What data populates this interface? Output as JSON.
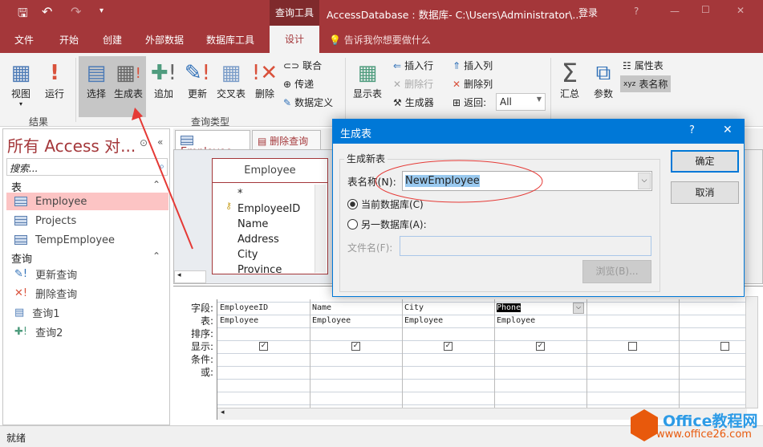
{
  "window": {
    "context_tab": "查询工具",
    "title": "AccessDatabase : 数据库- C:\\Users\\Administrator\\...",
    "signin": "登录",
    "help": "?",
    "minimize": "—",
    "maximize": "☐",
    "close": "✕"
  },
  "qat": {
    "save": "🖫",
    "undo": "↶",
    "redo": "↷",
    "more": "▾"
  },
  "tabs": [
    "文件",
    "开始",
    "创建",
    "外部数据",
    "数据库工具",
    "设计"
  ],
  "tell_me": "告诉我你想要做什么",
  "ribbon": {
    "results": {
      "label": "结果",
      "view": "视图",
      "run": "运行"
    },
    "query_type": {
      "label": "查询类型",
      "select": "选择",
      "make_table": "生成表",
      "append": "追加",
      "update": "更新",
      "crosstab": "交叉表",
      "delete": "删除",
      "union": "联合",
      "passthrough": "传递",
      "data_definition": "数据定义"
    },
    "query_setup": {
      "show_table": "显示表",
      "insert_rows": "插入行",
      "delete_rows": "删除行",
      "builder": "生成器",
      "insert_columns": "插入列",
      "delete_columns": "删除列",
      "return_label": "返回:",
      "return_value": "All"
    },
    "show_hide": {
      "totals": "汇总",
      "parameters": "参数",
      "property_sheet": "属性表",
      "table_names": "表名称"
    }
  },
  "nav": {
    "title": "所有 Access 对...",
    "search_placeholder": "搜索...",
    "tables_header": "表",
    "tables": [
      "Employee",
      "Projects",
      "TempEmployee"
    ],
    "queries_header": "查询",
    "queries": [
      "更新查询",
      "删除查询",
      "查询1",
      "查询2"
    ]
  },
  "doc_tabs": [
    "Employee",
    "删除查询"
  ],
  "field_list": {
    "title": "Employee",
    "fields": [
      "*",
      "EmployeeID",
      "Name",
      "Address",
      "City",
      "Province"
    ]
  },
  "grid": {
    "row_labels": [
      "字段:",
      "表:",
      "排序:",
      "显示:",
      "条件:",
      "或:"
    ],
    "columns": [
      {
        "field": "EmployeeID",
        "table": "Employee",
        "show": true
      },
      {
        "field": "Name",
        "table": "Employee",
        "show": true
      },
      {
        "field": "City",
        "table": "Employee",
        "show": true
      },
      {
        "field": "Phone",
        "table": "Employee",
        "show": true
      },
      {
        "field": "",
        "table": "",
        "show": false
      },
      {
        "field": "",
        "table": "",
        "show": false
      }
    ]
  },
  "dialog": {
    "title": "生成表",
    "help": "?",
    "close": "✕",
    "group": "生成新表",
    "table_name_label": "表名称(N):",
    "table_name_value": "NewEmployee",
    "current_db": "当前数据库(C)",
    "another_db": "另一数据库(A):",
    "filename_label": "文件名(F):",
    "filename_value": "",
    "browse": "浏览(B)...",
    "ok": "确定",
    "cancel": "取消",
    "selected_option": "current_db"
  },
  "status": {
    "text": "就绪"
  },
  "watermark": {
    "brand": "Office教程网",
    "url": "www.office26.com"
  },
  "colors": {
    "accent": "#a4373a",
    "dialog": "#0078d7",
    "annotation": "#e53935"
  }
}
